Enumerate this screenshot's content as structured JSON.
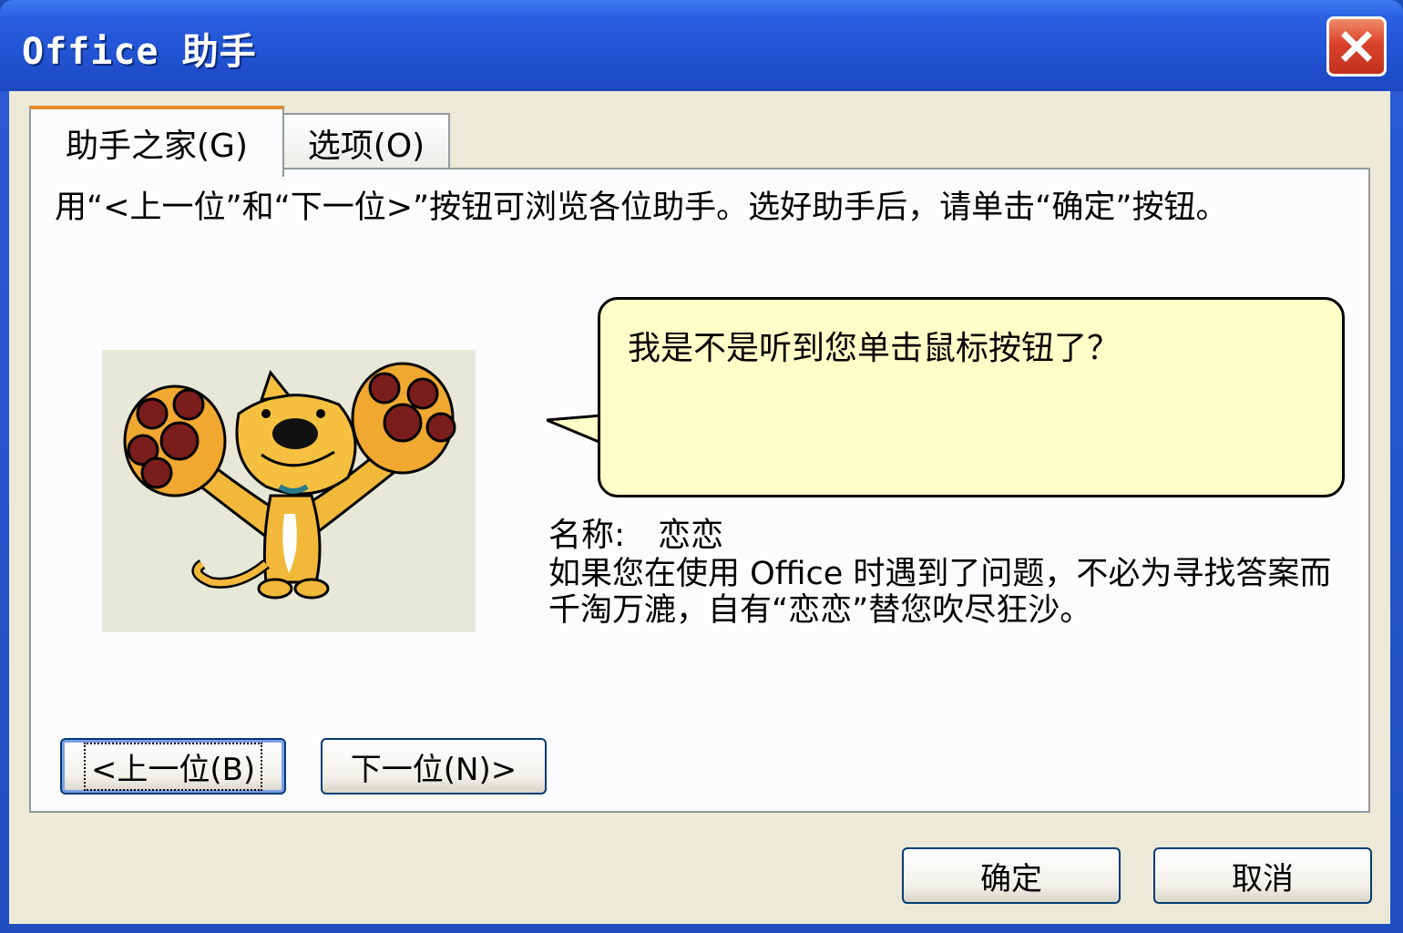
{
  "window": {
    "title": "Office 助手"
  },
  "tabs": [
    {
      "label": "助手之家(G)",
      "active": true
    },
    {
      "label": "选项(O)",
      "active": false
    }
  ],
  "panel": {
    "instructions": "用“<上一位”和“下一位>”按钮可浏览各位助手。选好助手后，请单击“确定”按钮。",
    "bubble_text": "我是不是听到您单击鼠标按钮了？",
    "name_label": "名称:",
    "name_value": "恋恋",
    "description": "如果您在使用 Office 时遇到了问题，不必为寻找答案而千淘万漉，自有“恋恋”替您吹尽狂沙。",
    "prev_label": "<上一位(B)",
    "next_label": "下一位(N)>"
  },
  "footer": {
    "ok_label": "确定",
    "cancel_label": "取消"
  },
  "colors": {
    "title_bar": "#2153d2",
    "client_bg": "#ece9d8",
    "bubble_bg": "#ffffc8",
    "active_tab_accent": "#e68b2c",
    "close_button": "#d9422b"
  },
  "icons": {
    "close": "close-icon",
    "assistant": "cat-assistant-image"
  }
}
